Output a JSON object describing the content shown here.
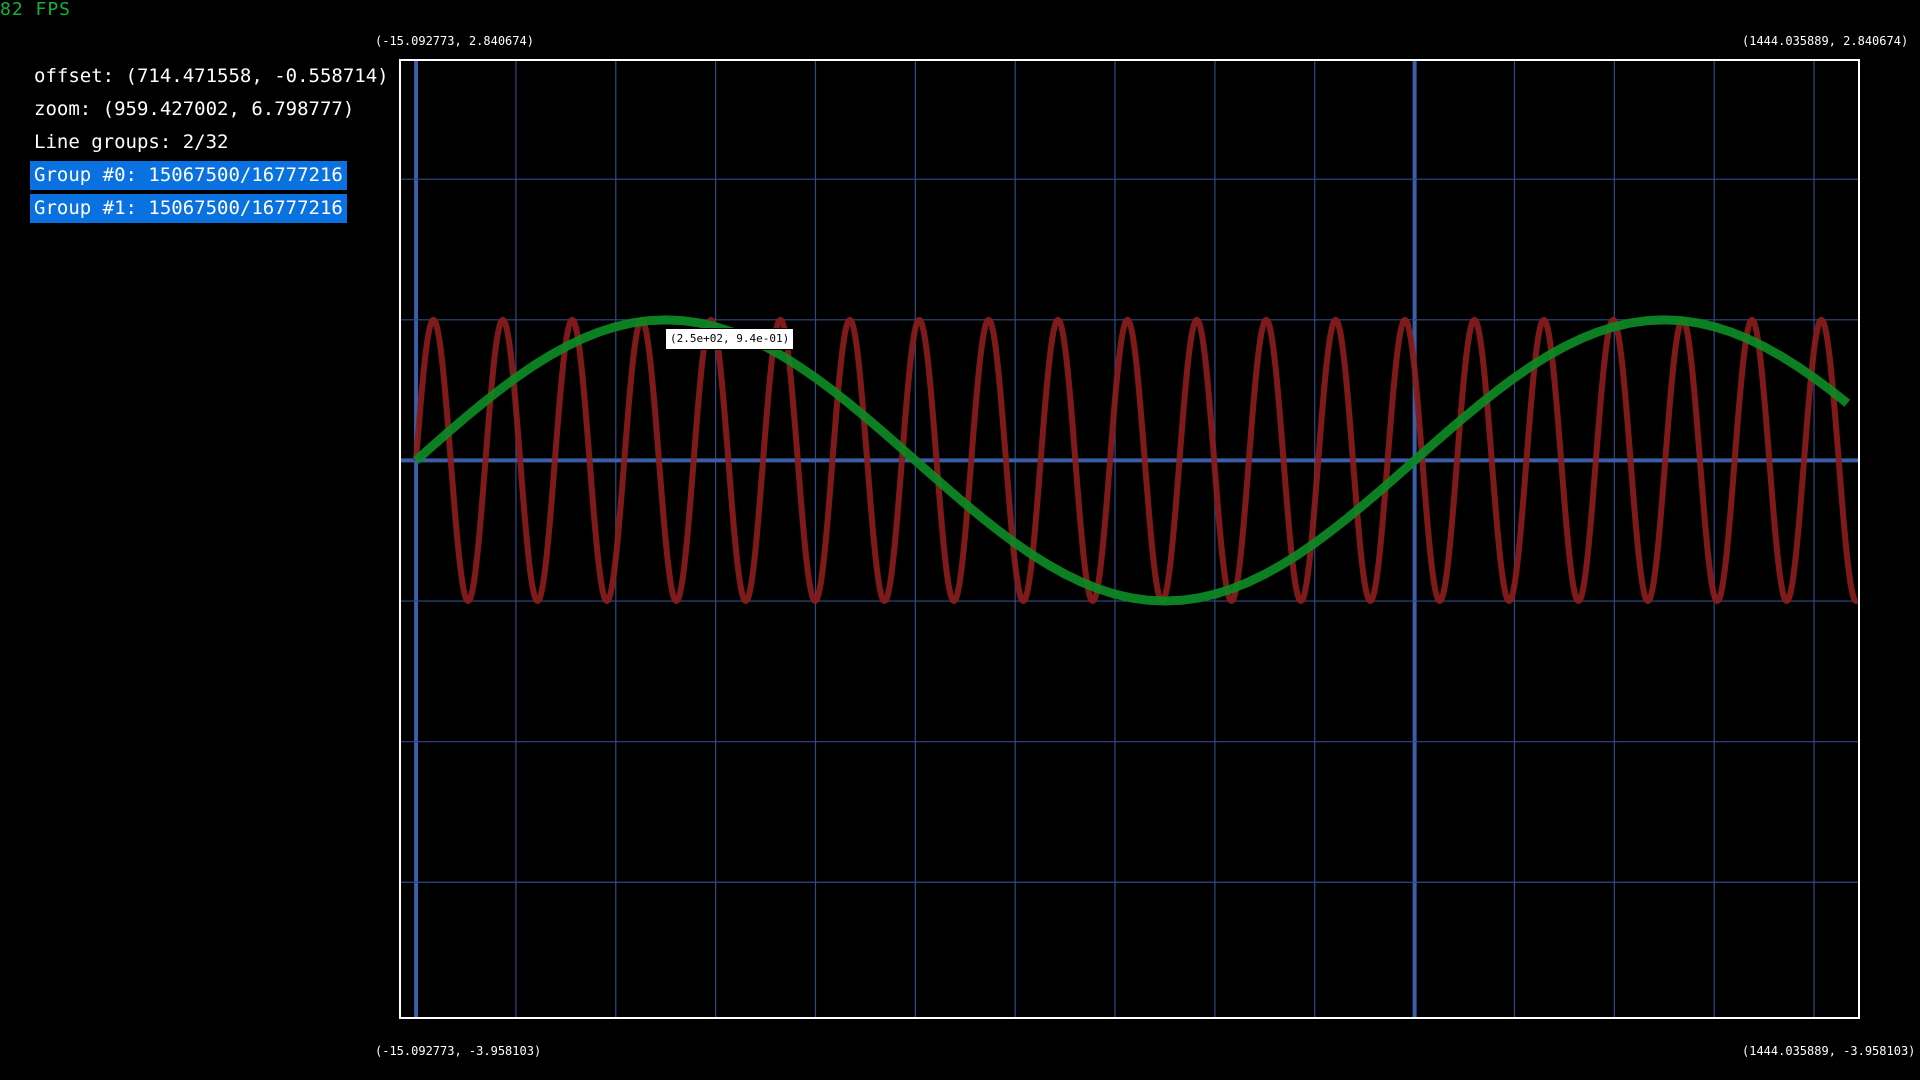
{
  "fps": "82 FPS",
  "info": {
    "offset": "offset: (714.471558, -0.558714)",
    "zoom": "zoom: (959.427002, 6.798777)",
    "line_groups": "Line groups: 2/32",
    "groups": [
      "Group #0: 15067500/16777216",
      "Group #1: 15067500/16777216"
    ]
  },
  "corners": {
    "top_left": "(-15.092773, 2.840674)",
    "top_right": "(1444.035889, 2.840674)",
    "bottom_left": "(-15.092773, -3.958103)",
    "bottom_right": "(1444.035889, -3.958103)"
  },
  "tooltip": "(2.5e+02, 9.4e-01)",
  "colors": {
    "background": "#000000",
    "grid": "#2f4a86",
    "axis": "#3a5ea8",
    "series_fast": "#8a1c1c",
    "series_slow": "#0c8a24",
    "fps": "#11b33a",
    "group_highlight": "#0a72e0"
  },
  "chart_data": {
    "type": "line",
    "xlim": [
      -15.092773,
      1444.035889
    ],
    "ylim": [
      -3.958103,
      2.840674
    ],
    "series": [
      {
        "kind": "sin",
        "amplitude": 1,
        "period": 69.5,
        "color_key": "series_fast"
      },
      {
        "kind": "sin",
        "amplitude": 1,
        "period": 1000,
        "color_key": "series_slow"
      }
    ]
  }
}
